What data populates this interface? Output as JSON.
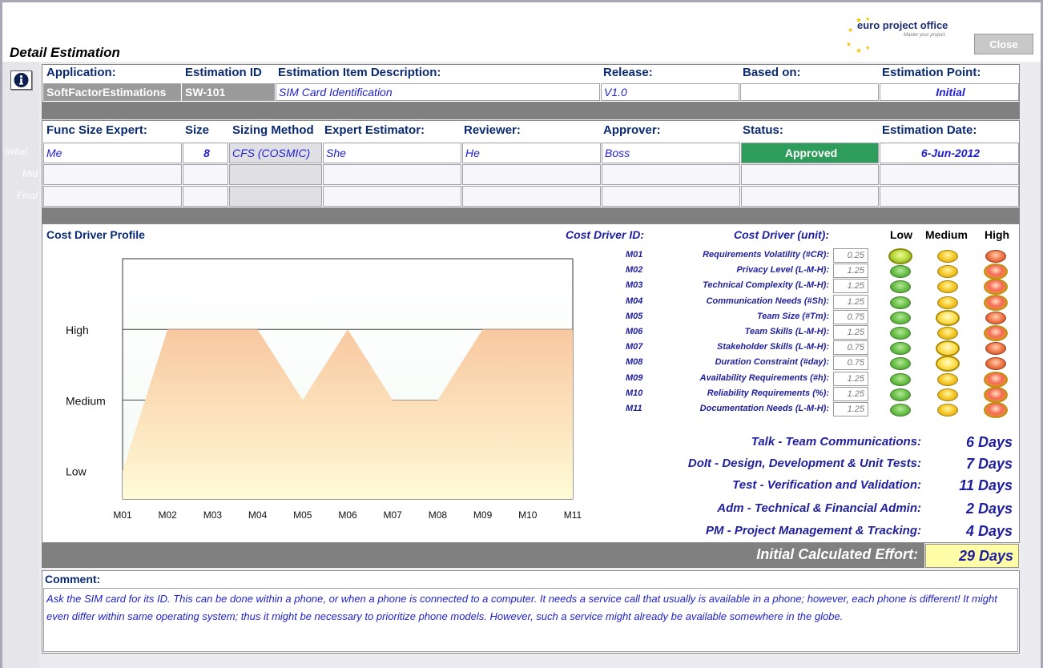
{
  "window": {
    "title": "Detail Estimation",
    "close_label": "Close"
  },
  "logo": {
    "name": "euro project office",
    "tagline": "Master your project."
  },
  "header": {
    "labels": {
      "application": "Application:",
      "estimation_id": "Estimation ID",
      "description": "Estimation Item Description:",
      "release": "Release:",
      "based_on": "Based on:",
      "estimation_point": "Estimation Point:"
    },
    "values": {
      "application": "SoftFactorEstimations",
      "estimation_id": "SW-101",
      "description": "SIM Card Identification",
      "release": "V1.0",
      "based_on": "",
      "estimation_point": "Initial"
    }
  },
  "team": {
    "labels": {
      "func_size_expert": "Func Size Expert:",
      "size": "Size",
      "sizing_method": "Sizing Method",
      "expert_estimator": "Expert Estimator:",
      "reviewer": "Reviewer:",
      "approver": "Approver:",
      "status": "Status:",
      "estimation_date": "Estimation Date:"
    },
    "rows": [
      {
        "label": "Initial",
        "func_size_expert": "Me",
        "size": "8",
        "sizing_method": "CFS (COSMIC)",
        "expert_estimator": "She",
        "reviewer": "He",
        "approver": "Boss",
        "status": "Approved",
        "estimation_date": "6-Jun-2012"
      },
      {
        "label": "Mid",
        "func_size_expert": "",
        "size": "",
        "sizing_method": "",
        "expert_estimator": "",
        "reviewer": "",
        "approver": "",
        "status": "",
        "estimation_date": ""
      },
      {
        "label": "Final",
        "func_size_expert": "",
        "size": "",
        "sizing_method": "",
        "expert_estimator": "",
        "reviewer": "",
        "approver": "",
        "status": "",
        "estimation_date": ""
      }
    ],
    "status_color": "#2e9c5a"
  },
  "profile": {
    "title": "Cost Driver Profile",
    "id_header": "Cost Driver ID:",
    "unit_header": "Cost Driver (unit):",
    "level_headers": [
      "Low",
      "Medium",
      "High"
    ],
    "drivers": [
      {
        "id": "M01",
        "name": "Requirements Volatility (#CR):",
        "value": "0.25",
        "level": "Low"
      },
      {
        "id": "M02",
        "name": "Privacy Level (L-M-H):",
        "value": "1.25",
        "level": "High"
      },
      {
        "id": "M03",
        "name": "Technical Complexity (L-M-H):",
        "value": "1.25",
        "level": "High"
      },
      {
        "id": "M04",
        "name": "Communication Needs (#Sh):",
        "value": "1.25",
        "level": "High"
      },
      {
        "id": "M05",
        "name": "Team Size (#Tm):",
        "value": "0.75",
        "level": "Medium"
      },
      {
        "id": "M06",
        "name": "Team Skills (L-M-H):",
        "value": "1.25",
        "level": "High"
      },
      {
        "id": "M07",
        "name": "Stakeholder Skills (L-M-H):",
        "value": "0.75",
        "level": "Medium"
      },
      {
        "id": "M08",
        "name": "Duration Constraint (#day):",
        "value": "0.75",
        "level": "Medium"
      },
      {
        "id": "M09",
        "name": "Availability Requirements (#h):",
        "value": "1.25",
        "level": "High"
      },
      {
        "id": "M10",
        "name": "Reliability Requirements (%):",
        "value": "1.25",
        "level": "High"
      },
      {
        "id": "M11",
        "name": "Documentation Needs (L-M-H):",
        "value": "1.25",
        "level": "High"
      }
    ]
  },
  "chart_data": {
    "type": "area",
    "title": "",
    "categories": [
      "M01",
      "M02",
      "M03",
      "M04",
      "M05",
      "M06",
      "M07",
      "M08",
      "M09",
      "M10",
      "M11"
    ],
    "y_categories": [
      "Low",
      "Medium",
      "High"
    ],
    "values": [
      1,
      3,
      3,
      3,
      2,
      3,
      2,
      2,
      3,
      3,
      3
    ],
    "ylim": [
      1,
      4
    ],
    "grid": true,
    "fill_top": "#f8c8a0",
    "fill_bottom": "#fffbd8"
  },
  "efforts": [
    {
      "label": "Talk - Team Communications:",
      "value": "6 Days"
    },
    {
      "label": "DoIt - Design, Development & Unit Tests:",
      "value": "7 Days"
    },
    {
      "label": "Test - Verification and Validation:",
      "value": "11 Days"
    },
    {
      "label": "Adm - Technical & Financial Admin:",
      "value": "2 Days"
    },
    {
      "label": "PM - Project Management & Tracking:",
      "value": "4 Days"
    }
  ],
  "total": {
    "label": "Initial Calculated Effort:",
    "value": "29 Days"
  },
  "comment": {
    "label": "Comment:",
    "text": "Ask the SIM card for its ID. This can be done within a phone, or when a phone is connected to a computer. It needs a service call that usually is available in a phone; however, each phone is different! It might even differ within same operating system; thus it might be necessary to prioritize phone models. However, such a service might already be available somewhere in the globe."
  }
}
